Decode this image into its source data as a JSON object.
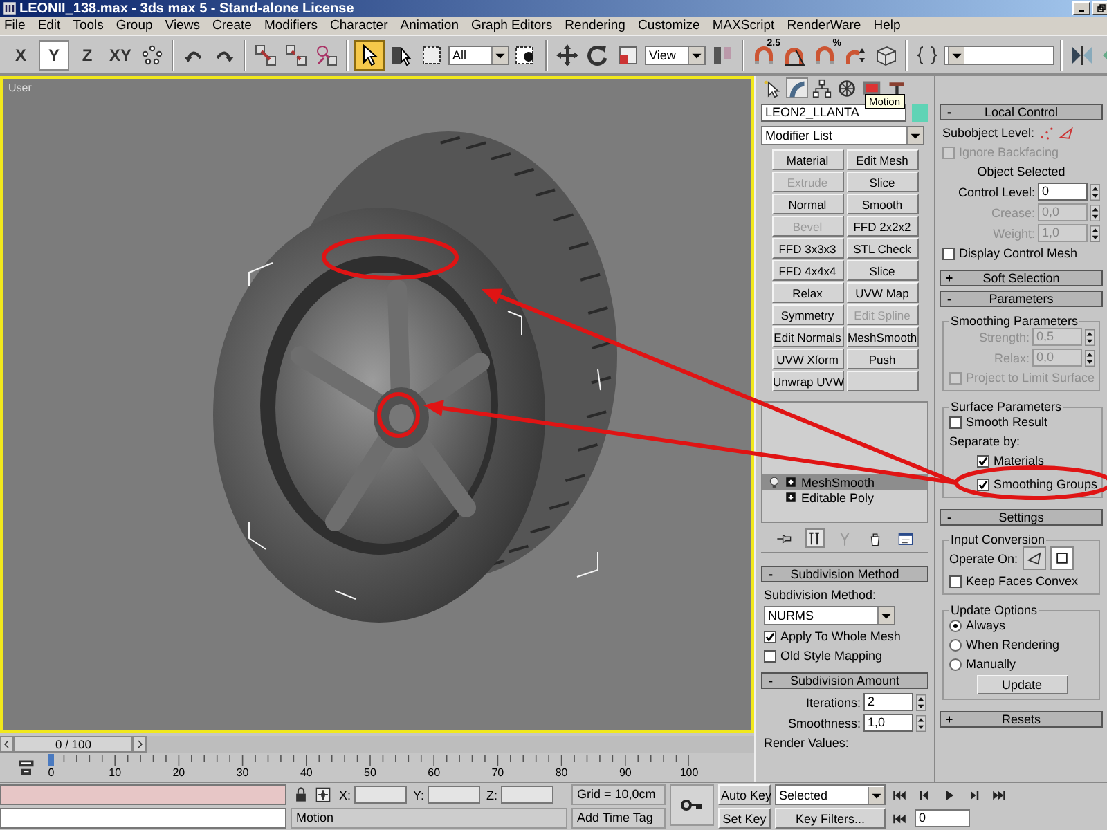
{
  "window": {
    "title": "LEONII_138.max - 3ds max 5 - Stand-alone License"
  },
  "menu": [
    "File",
    "Edit",
    "Tools",
    "Group",
    "Views",
    "Create",
    "Modifiers",
    "Character",
    "Animation",
    "Graph Editors",
    "Rendering",
    "Customize",
    "MAXScript",
    "RenderWare",
    "Help"
  ],
  "toolbar": {
    "axes": [
      {
        "label": "X",
        "selected": false
      },
      {
        "label": "Y",
        "selected": true
      },
      {
        "label": "Z",
        "selected": false
      },
      {
        "label": "XY",
        "selected": false
      }
    ],
    "select_tool": {
      "selected": true
    },
    "selection_filter": "All",
    "reference_coordinate": "View",
    "snap_label": "2.5",
    "percent_label": "%"
  },
  "viewport": {
    "label": "User"
  },
  "time_slider": {
    "label": "0 / 100"
  },
  "ruler": {
    "ticks": [
      "0",
      "10",
      "20",
      "30",
      "40",
      "50",
      "60",
      "70",
      "80",
      "90",
      "100"
    ]
  },
  "command_panel": {
    "tabs": [
      {
        "selected": false
      },
      {
        "selected": true
      },
      {
        "selected": false
      },
      {
        "selected": false
      },
      {
        "selected": false
      },
      {
        "selected": false
      }
    ],
    "tooltip": "Motion",
    "object_name": "LEON2_LLANTA",
    "modifier_list": "Modifier List",
    "modifier_buttons": [
      {
        "label": "Material",
        "disabled": false
      },
      {
        "label": "Edit Mesh",
        "disabled": false
      },
      {
        "label": "Extrude",
        "disabled": true
      },
      {
        "label": "Slice",
        "disabled": false
      },
      {
        "label": "Normal",
        "disabled": false
      },
      {
        "label": "Smooth",
        "disabled": false
      },
      {
        "label": "Bevel",
        "disabled": true
      },
      {
        "label": "FFD 2x2x2",
        "disabled": false
      },
      {
        "label": "FFD 3x3x3",
        "disabled": false
      },
      {
        "label": "STL Check",
        "disabled": false
      },
      {
        "label": "FFD 4x4x4",
        "disabled": false
      },
      {
        "label": "Slice",
        "disabled": false
      },
      {
        "label": "Relax",
        "disabled": false
      },
      {
        "label": "UVW Map",
        "disabled": false
      },
      {
        "label": "Symmetry",
        "disabled": false
      },
      {
        "label": "Edit Spline",
        "disabled": true
      },
      {
        "label": "Edit Normals",
        "disabled": false
      },
      {
        "label": "MeshSmooth",
        "disabled": false
      },
      {
        "label": "UVW Xform",
        "disabled": false
      },
      {
        "label": "Push",
        "disabled": false
      },
      {
        "label": "Unwrap UVW",
        "disabled": false
      }
    ],
    "stack": [
      {
        "label": "MeshSmooth",
        "selected": true
      },
      {
        "label": "Editable Poly",
        "selected": false
      }
    ],
    "stack_tools": [
      {
        "selected": false
      },
      {
        "selected": true
      },
      {
        "selected": false
      },
      {
        "selected": false
      },
      {
        "selected": false
      }
    ],
    "left_rollouts": [
      {
        "title": "Subdivision Method",
        "sign": "-",
        "controls": [
          {
            "kind": "label",
            "text": "Subdivision Method:"
          },
          {
            "kind": "dropdown",
            "value": "NURMS"
          },
          {
            "kind": "check",
            "label": "Apply To Whole Mesh",
            "checked": true,
            "disabled": false
          },
          {
            "kind": "check",
            "label": "Old Style Mapping",
            "checked": false,
            "disabled": false
          }
        ]
      },
      {
        "title": "Subdivision Amount",
        "sign": "-",
        "controls": [
          {
            "kind": "spinner",
            "label": "Iterations:",
            "value": "2",
            "disabled": false
          },
          {
            "kind": "spinner",
            "label": "Smoothness:",
            "value": "1,0",
            "disabled": false
          },
          {
            "kind": "label",
            "text": "Render Values:"
          }
        ]
      }
    ],
    "right_rollouts": [
      {
        "title": "Local Control",
        "sign": "-",
        "controls": [
          {
            "kind": "subobject",
            "label": "Subobject Level:"
          },
          {
            "kind": "check",
            "label": "Ignore Backfacing",
            "checked": false,
            "disabled": true
          },
          {
            "kind": "caption",
            "text": "Object Selected"
          },
          {
            "kind": "spinner",
            "label": "Control Level:",
            "value": "0",
            "disabled": false
          },
          {
            "kind": "spinner",
            "label": "Crease:",
            "value": "0,0",
            "disabled": true
          },
          {
            "kind": "spinner",
            "label": "Weight:",
            "value": "1,0",
            "disabled": true
          },
          {
            "kind": "check",
            "label": "Display Control Mesh",
            "checked": false,
            "disabled": false
          }
        ]
      },
      {
        "title": "Soft Selection",
        "sign": "+"
      },
      {
        "title": "Parameters",
        "sign": "-",
        "controls": [
          {
            "kind": "group",
            "title": "Smoothing Parameters",
            "controls": [
              {
                "kind": "spinner",
                "label": "Strength:",
                "value": "0,5",
                "disabled": true
              },
              {
                "kind": "spinner",
                "label": "Relax:",
                "value": "0,0",
                "disabled": true
              },
              {
                "kind": "check",
                "label": "Project to Limit Surface",
                "checked": false,
                "disabled": true
              }
            ]
          },
          {
            "kind": "group",
            "title": "Surface Parameters",
            "controls": [
              {
                "kind": "check",
                "label": "Smooth Result",
                "checked": false,
                "disabled": false
              },
              {
                "kind": "label",
                "text": "Separate by:",
                "children": [
                  {
                    "kind": "check",
                    "label": "Materials",
                    "checked": true,
                    "disabled": false
                  },
                  {
                    "kind": "check",
                    "label": "Smoothing Groups",
                    "checked": true,
                    "disabled": false
                  }
                ]
              }
            ]
          }
        ]
      },
      {
        "title": "Settings",
        "sign": "-",
        "controls": [
          {
            "kind": "group",
            "title": "Input Conversion",
            "controls": [
              {
                "kind": "operate",
                "label": "Operate On:",
                "options": [
                  {
                    "selected": false
                  },
                  {
                    "selected": true
                  }
                ]
              },
              {
                "kind": "check",
                "label": "Keep Faces Convex",
                "checked": false,
                "disabled": false
              }
            ]
          },
          {
            "kind": "group",
            "title": "Update Options",
            "controls": [
              {
                "kind": "radio",
                "label": "Always",
                "selected": true
              },
              {
                "kind": "radio",
                "label": "When Rendering",
                "selected": false
              },
              {
                "kind": "radio",
                "label": "Manually",
                "selected": false
              },
              {
                "kind": "button",
                "label": "Update"
              }
            ]
          }
        ]
      },
      {
        "title": "Resets",
        "sign": "+"
      }
    ]
  },
  "status_bar": {
    "coords": [
      "X:",
      "Y:",
      "Z:"
    ],
    "grid": "Grid = 10,0cm",
    "prompt": "Motion",
    "add_time_tag": "Add Time Tag",
    "auto_key": "Auto Key",
    "set_key": "Set Key",
    "key_mode": "Selected",
    "key_filters": "Key Filters...",
    "frame": "0"
  }
}
